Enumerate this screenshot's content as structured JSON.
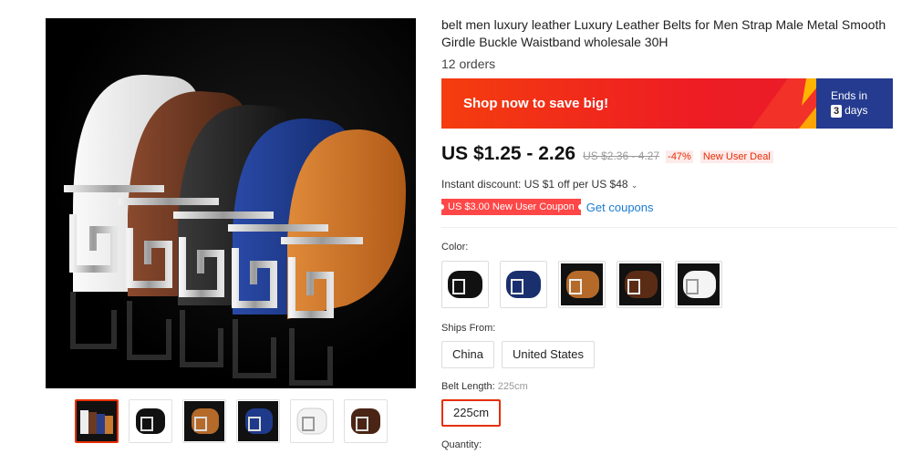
{
  "product": {
    "title": "belt men luxury leather Luxury Leather Belts for Men Strap Male Metal Smooth Girdle Buckle Waistband wholesale 30H",
    "orders": "12 orders"
  },
  "gallery": {
    "main_image": "product-belt-set-image",
    "thumbnails": [
      {
        "name": "thumb-belt-set",
        "active": true
      },
      {
        "name": "thumb-black-belt"
      },
      {
        "name": "thumb-brown-belt"
      },
      {
        "name": "thumb-blue-belt"
      },
      {
        "name": "thumb-white-belt"
      },
      {
        "name": "thumb-darkbrown-belt"
      }
    ]
  },
  "banner": {
    "text": "Shop now to save big!",
    "ends_in": "Ends in",
    "days_count": "3",
    "days_label": "days",
    "colors": {
      "bg": "#ee1d24",
      "right_bg": "#243b8f"
    }
  },
  "pricing": {
    "price": "US $1.25 - 2.26",
    "old_price": "US $2.36 - 4.27",
    "discount": "-47%",
    "new_user_deal": "New User Deal",
    "instant_discount": "Instant discount: US $1 off per US $48",
    "coupon": "US $3.00 New User Coupon",
    "get_coupons": "Get coupons",
    "accent_color": "#e62e04"
  },
  "options": {
    "color_label": "Color:",
    "colors": [
      "black",
      "blue",
      "brown",
      "dark-brown",
      "white"
    ],
    "ships_label": "Ships From:",
    "ships_from": [
      "China",
      "United States"
    ],
    "length_label": "Belt Length:",
    "length_value": "225cm",
    "length_options": [
      "225cm"
    ],
    "quantity_label": "Quantity:"
  }
}
